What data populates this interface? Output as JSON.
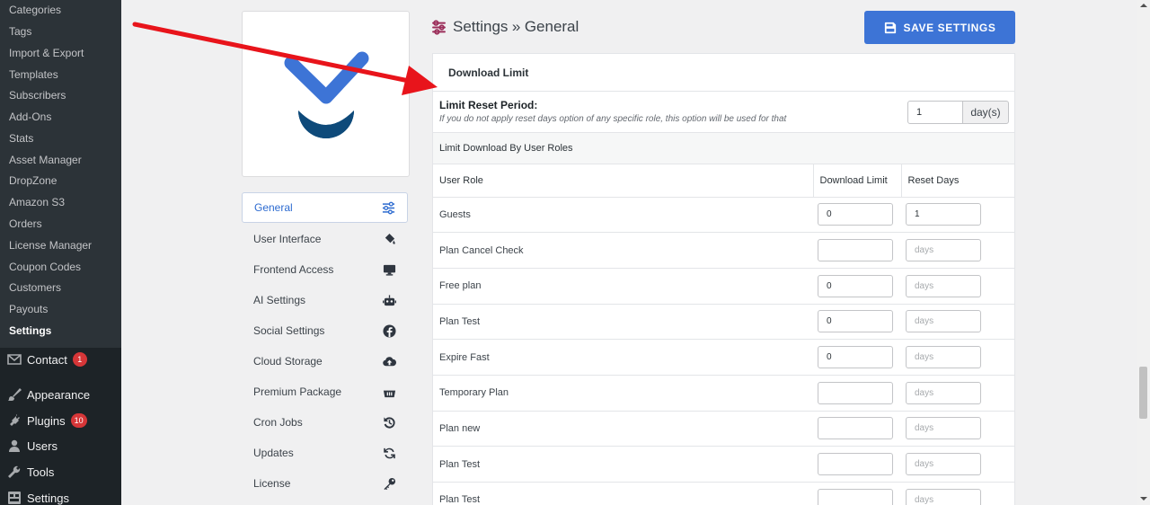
{
  "sidebar": {
    "submenu": [
      "Categories",
      "Tags",
      "Import & Export",
      "Templates",
      "Subscribers",
      "Add-Ons",
      "Stats",
      "Asset Manager",
      "DropZone",
      "Amazon S3",
      "Orders",
      "License Manager",
      "Coupon Codes",
      "Customers",
      "Payouts",
      "Settings"
    ],
    "menu": [
      {
        "label": "Contact",
        "icon": "mail-icon",
        "badge": "1"
      },
      {
        "label": "Appearance",
        "icon": "paintbrush-icon"
      },
      {
        "label": "Plugins",
        "icon": "plugin-icon",
        "badge": "10"
      },
      {
        "label": "Users",
        "icon": "users-icon"
      },
      {
        "label": "Tools",
        "icon": "wrench-icon"
      },
      {
        "label": "Settings",
        "icon": "settings-icon"
      }
    ]
  },
  "settings_nav": [
    {
      "label": "General",
      "icon": "sliders-icon"
    },
    {
      "label": "User Interface",
      "icon": "paint-bucket-icon"
    },
    {
      "label": "Frontend Access",
      "icon": "desktop-icon"
    },
    {
      "label": "AI Settings",
      "icon": "robot-icon"
    },
    {
      "label": "Social Settings",
      "icon": "facebook-icon"
    },
    {
      "label": "Cloud Storage",
      "icon": "cloud-upload-icon"
    },
    {
      "label": "Premium Package",
      "icon": "basket-icon"
    },
    {
      "label": "Cron Jobs",
      "icon": "history-icon"
    },
    {
      "label": "Updates",
      "icon": "sync-icon"
    },
    {
      "label": "License",
      "icon": "key-icon"
    }
  ],
  "header": {
    "title": "Settings",
    "separator": "»",
    "subtitle": "General"
  },
  "save_button": "SAVE SETTINGS",
  "panel": {
    "title": "Download Limit",
    "reset_label": "Limit Reset Period:",
    "reset_desc": "If you do not apply reset days option of any specific role, this option will be used for that",
    "reset_value": "1",
    "reset_unit": "day(s)",
    "section_title": "Limit Download By User Roles",
    "columns": [
      "User Role",
      "Download Limit",
      "Reset Days"
    ],
    "days_placeholder": "days",
    "rows": [
      {
        "role": "Guests",
        "limit": "0",
        "days": "1"
      },
      {
        "role": "Plan Cancel Check",
        "limit": "",
        "days": ""
      },
      {
        "role": "Free plan",
        "limit": "0",
        "days": ""
      },
      {
        "role": "Plan Test",
        "limit": "0",
        "days": ""
      },
      {
        "role": "Expire Fast",
        "limit": "0",
        "days": ""
      },
      {
        "role": "Temporary Plan",
        "limit": "",
        "days": ""
      },
      {
        "role": "Plan new",
        "limit": "",
        "days": ""
      },
      {
        "role": "Plan Test",
        "limit": "",
        "days": ""
      },
      {
        "role": "Plan Test",
        "limit": "",
        "days": ""
      }
    ]
  },
  "colors": {
    "accent": "#3d74d6",
    "sidebar_bg": "#1d2327",
    "arrow": "#e8141b",
    "logo_blue": "#3d74d6",
    "logo_navy": "#0e4a7a"
  }
}
